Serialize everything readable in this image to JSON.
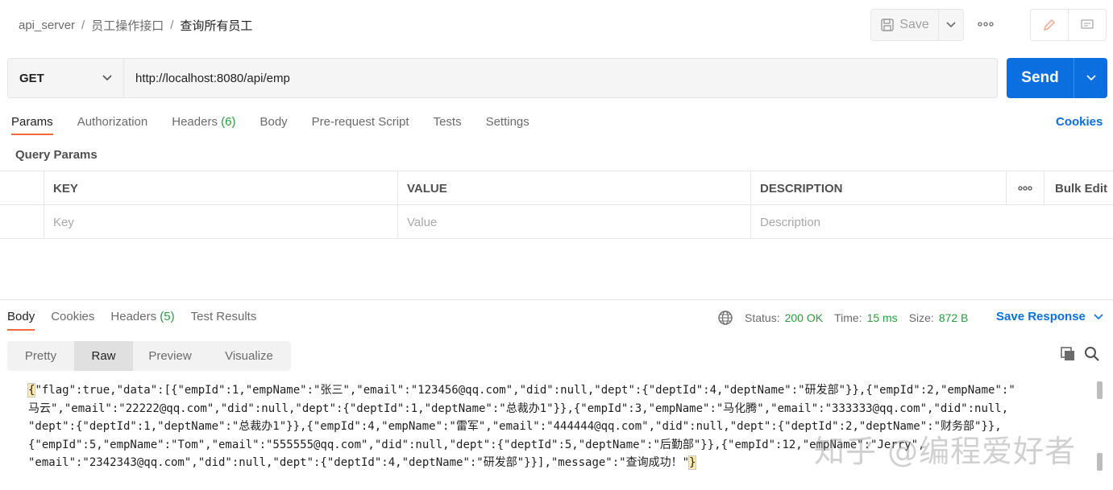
{
  "breadcrumb": {
    "root": "api_server",
    "sep": "/",
    "folder": "员工操作接口",
    "current": "查询所有员工"
  },
  "toolbar": {
    "save_label": "Save",
    "more_label": "ooo"
  },
  "request": {
    "method": "GET",
    "url": "http://localhost:8080/api/emp",
    "send_label": "Send"
  },
  "request_tabs": [
    {
      "label": "Params"
    },
    {
      "label": "Authorization"
    },
    {
      "label": "Headers",
      "count": "(6)"
    },
    {
      "label": "Body"
    },
    {
      "label": "Pre-request Script"
    },
    {
      "label": "Tests"
    },
    {
      "label": "Settings"
    }
  ],
  "cookies_link": "Cookies",
  "query_params": {
    "title": "Query Params",
    "headers": {
      "key": "KEY",
      "value": "VALUE",
      "description": "DESCRIPTION",
      "more": "ooo",
      "bulk_edit": "Bulk Edit"
    },
    "placeholders": {
      "key": "Key",
      "value": "Value",
      "description": "Description"
    }
  },
  "response_tabs": [
    {
      "label": "Body"
    },
    {
      "label": "Cookies"
    },
    {
      "label": "Headers",
      "count": "(5)"
    },
    {
      "label": "Test Results"
    }
  ],
  "status": {
    "status_label": "Status:",
    "status_value": "200 OK",
    "time_label": "Time:",
    "time_value": "15 ms",
    "size_label": "Size:",
    "size_value": "872 B"
  },
  "save_response_label": "Save Response",
  "view_modes": [
    "Pretty",
    "Raw",
    "Preview",
    "Visualize"
  ],
  "raw_body": {
    "line1_brace": "{",
    "line1": "\"flag\":true,\"data\":[{\"empId\":1,\"empName\":\"张三\",\"email\":\"123456@qq.com\",\"did\":null,\"dept\":{\"deptId\":4,\"deptName\":\"研发部\"}},{\"empId\":2,\"empName\":\"",
    "line2": "马云\",\"email\":\"22222@qq.com\",\"did\":null,\"dept\":{\"deptId\":1,\"deptName\":\"总裁办1\"}},{\"empId\":3,\"empName\":\"马化腾\",\"email\":\"333333@qq.com\",\"did\":null,",
    "line3": "\"dept\":{\"deptId\":1,\"deptName\":\"总裁办1\"}},{\"empId\":4,\"empName\":\"雷军\",\"email\":\"444444@qq.com\",\"did\":null,\"dept\":{\"deptId\":2,\"deptName\":\"财务部\"}},",
    "line4": "{\"empId\":5,\"empName\":\"Tom\",\"email\":\"555555@qq.com\",\"did\":null,\"dept\":{\"deptId\":5,\"deptName\":\"后勤部\"}},{\"empId\":12,\"empName\":\"Jerry\",",
    "line5": "\"email\":\"2342343@qq.com\",\"did\":null,\"dept\":{\"deptId\":4,\"deptName\":\"研发部\"}}],\"message\":\"查询成功！\"",
    "line5_brace": "}"
  },
  "watermark": "知乎 @编程爱好者",
  "colors": {
    "accent": "#f26b3a",
    "primary": "#0b6fe0",
    "success": "#2a9d3f"
  }
}
